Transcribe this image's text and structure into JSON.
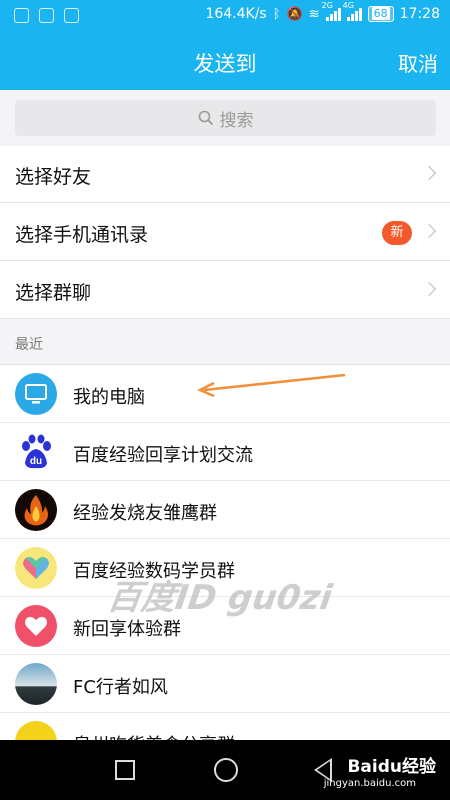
{
  "status_bar": {
    "speed": "164.4K/s",
    "net_2g": "2G",
    "net_4g": "4G",
    "battery": "68",
    "time": "17:28",
    "icons": [
      "app-icon",
      "app-icon",
      "app-icon",
      "bluetooth-icon",
      "mute-icon",
      "wifi-icon",
      "signal-icon",
      "battery-icon"
    ]
  },
  "header": {
    "title": "发送到",
    "cancel": "取消"
  },
  "search": {
    "placeholder": "搜索"
  },
  "menu": [
    {
      "label": "选择好友",
      "badge": ""
    },
    {
      "label": "选择手机通讯录",
      "badge": "新"
    },
    {
      "label": "选择群聊",
      "badge": ""
    }
  ],
  "section_label": "最近",
  "contacts": [
    {
      "name": "我的电脑",
      "avatar": "computer-icon"
    },
    {
      "name": "百度经验回享计划交流",
      "avatar": "baidu-paw-icon"
    },
    {
      "name": "经验发烧友雏鹰群",
      "avatar": "fire-avatar"
    },
    {
      "name": "百度经验数码学员群",
      "avatar": "heart-avatar"
    },
    {
      "name": "新回享体验群",
      "avatar": "heart-icon"
    },
    {
      "name": "FC行者如风",
      "avatar": "landscape-avatar"
    },
    {
      "name": "泉州吃货美食分享群",
      "avatar": "yellow-text-avatar"
    }
  ],
  "watermark": "百度ID gu0zi",
  "corner_logo": "Baidu经验",
  "corner_sub": "jingyan.baidu.com",
  "colors": {
    "accent": "#1ab5f0",
    "badge": "#f25a2b",
    "arrow": "#f0913a"
  }
}
